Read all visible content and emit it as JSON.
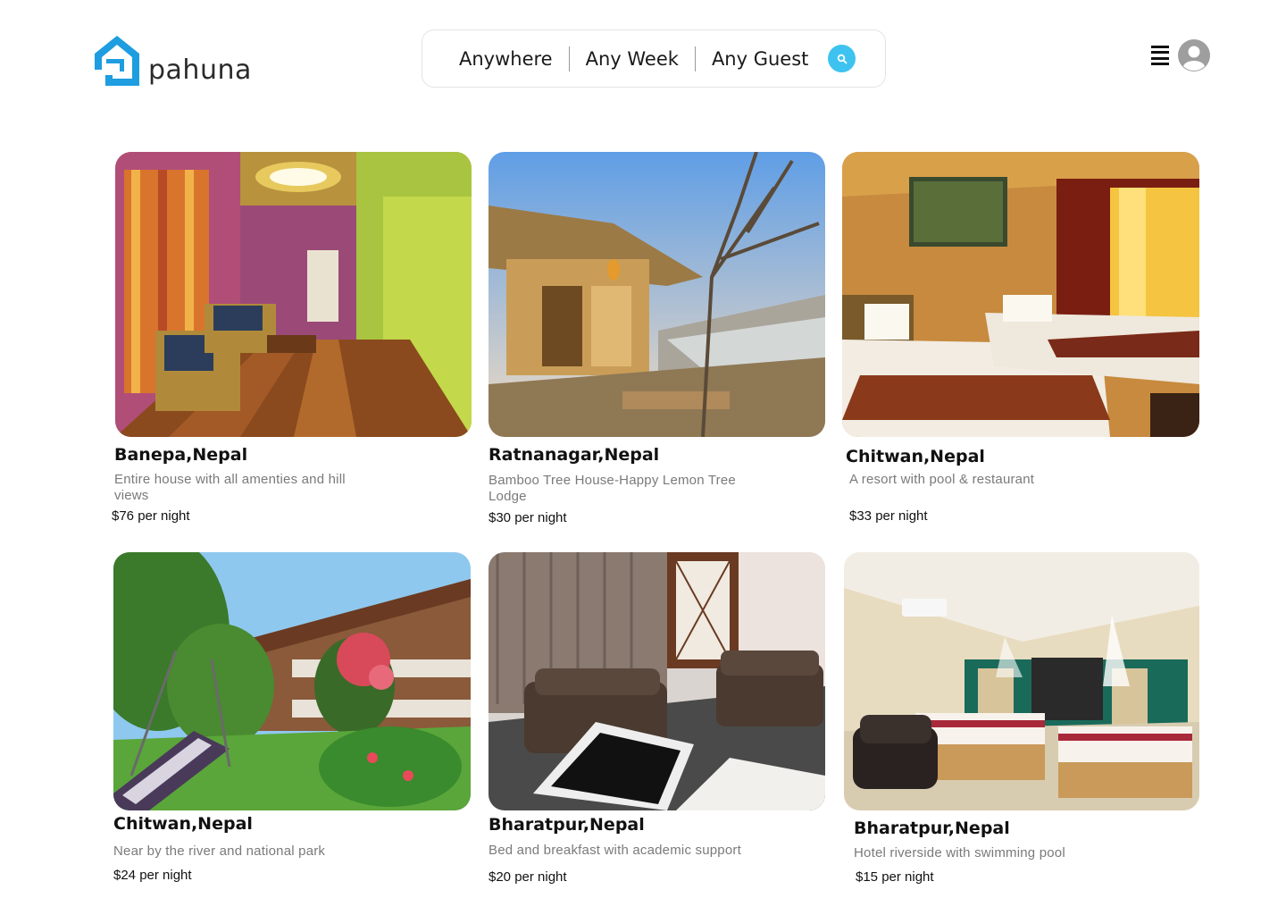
{
  "brand": {
    "name": "pahuna",
    "color": "#1e9de0"
  },
  "search": {
    "where_label": "Anywhere",
    "week_label": "Any Week",
    "guest_label": "Any Guest",
    "button_color": "#3ec3f0"
  },
  "header": {
    "menu_icon": "hamburger-icon",
    "avatar_icon": "user-avatar-icon"
  },
  "listings": [
    {
      "location": "Banepa,Nepal",
      "description": "Entire house with all amenties and hill views",
      "price": "$76 per night"
    },
    {
      "location": "Ratnanagar,Nepal",
      "description": "Bamboo Tree House-Happy Lemon Tree Lodge",
      "price": "$30 per night"
    },
    {
      "location": "Chitwan,Nepal",
      "description": "A resort with pool & restaurant",
      "price": "$33 per night"
    },
    {
      "location": "Chitwan,Nepal",
      "description": "Near by the river and national park",
      "price": "$24 per night"
    },
    {
      "location": "Bharatpur,Nepal",
      "description": "Bed and breakfast with academic support",
      "price": "$20 per night"
    },
    {
      "location": "Bharatpur,Nepal",
      "description": "Hotel riverside with swimming pool",
      "price": "$15 per night"
    }
  ]
}
